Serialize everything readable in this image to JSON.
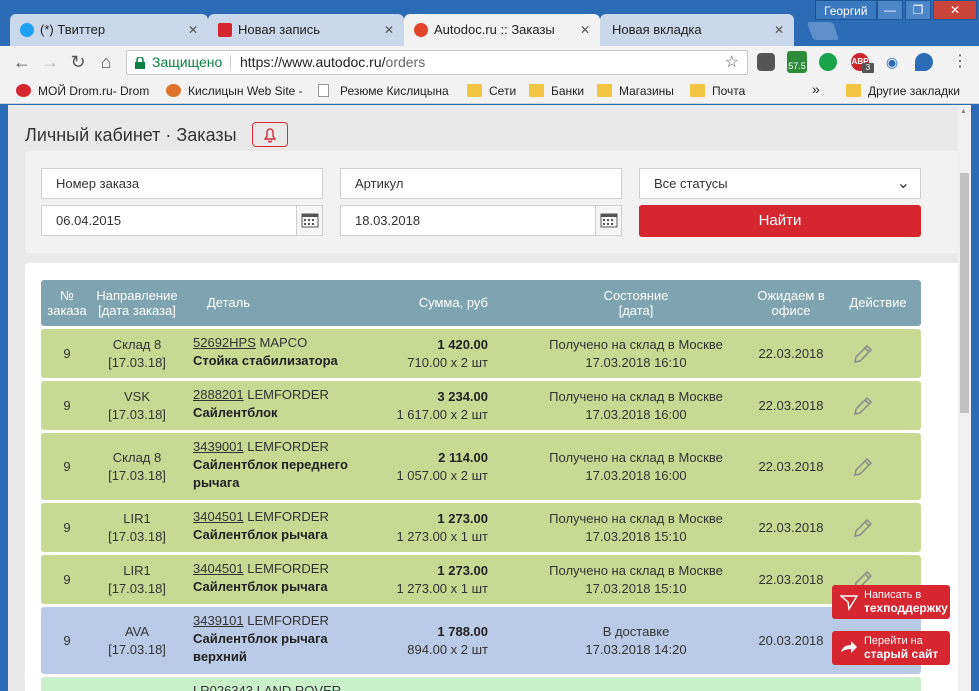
{
  "window": {
    "profile": "Георгий",
    "min": "—",
    "restore": "❐",
    "close": "✕"
  },
  "tabs": [
    {
      "label": "(*) Твиттер",
      "icon_color": "#1da1f2"
    },
    {
      "label": "Новая запись",
      "icon_color": "#d6262f"
    },
    {
      "label": "Autodoc.ru :: Заказы",
      "icon_color": "#e2452b"
    },
    {
      "label": "Новая вкладка",
      "icon_color": ""
    }
  ],
  "tab_close": "✕",
  "toolbar": {
    "secure_label": "Защищено",
    "url_host": "https://www.autodoc.ru/",
    "url_path": "orders",
    "star": "☆",
    "menu": "⋮",
    "ext_price": "57.5",
    "ext_abp_count": "3"
  },
  "bookmarks": [
    {
      "label": "МОЙ Drom.ru- Drom"
    },
    {
      "label": "Кислицын Web Site -"
    },
    {
      "label": "Резюме Кислицына"
    },
    {
      "label": "Сети"
    },
    {
      "label": "Банки"
    },
    {
      "label": "Магазины"
    },
    {
      "label": "Почта"
    }
  ],
  "bookmarks_more": "»",
  "bookmarks_other": "Другие закладки",
  "page": {
    "title": "Личный кабинет · Заказы"
  },
  "filters": {
    "order_number": "Номер заказа",
    "article": "Артикул",
    "status": "Все статусы",
    "date_from": "06.04.2015",
    "date_to": "18.03.2018",
    "find": "Найти"
  },
  "table": {
    "headers": {
      "num": [
        "№",
        "заказа"
      ],
      "dir": [
        "Направление",
        "[дата заказа]"
      ],
      "part": "Деталь",
      "sum": "Сумма, руб",
      "state": [
        "Состояние",
        "[дата]"
      ],
      "expect": [
        "Ожидаем в",
        "офисе"
      ],
      "action": "Действие"
    },
    "rows": [
      {
        "num": "9",
        "dir": "Склад 8",
        "date": "[17.03.18]",
        "code": "52692HPS",
        "brand": "MAPCO",
        "name": "Стойка стабилизатора",
        "name2": "",
        "total": "1 420.00",
        "unit": "710.00 x 2 шт",
        "state": "Получено на склад в Москве",
        "state_date": "17.03.2018 16:10",
        "expect": "22.03.2018",
        "color": "green"
      },
      {
        "num": "9",
        "dir": "VSK",
        "date": "[17.03.18]",
        "code": "2888201",
        "brand": "LEMFORDER",
        "name": "Сайлентблок",
        "name2": "",
        "total": "3 234.00",
        "unit": "1 617.00 x 2 шт",
        "state": "Получено на склад в Москве",
        "state_date": "17.03.2018 16:00",
        "expect": "22.03.2018",
        "color": "green"
      },
      {
        "num": "9",
        "dir": "Склад 8",
        "date": "[17.03.18]",
        "code": "3439001",
        "brand": "LEMFORDER",
        "name": "Сайлентблок переднего",
        "name2": "рычага",
        "total": "2 114.00",
        "unit": "1 057.00 x 2 шт",
        "state": "Получено на склад в Москве",
        "state_date": "17.03.2018 16:00",
        "expect": "22.03.2018",
        "color": "green"
      },
      {
        "num": "9",
        "dir": "LIR1",
        "date": "[17.03.18]",
        "code": "3404501",
        "brand": "LEMFORDER",
        "name": "Сайлентблок рычага",
        "name2": "",
        "total": "1 273.00",
        "unit": "1 273.00 x 1 шт",
        "state": "Получено на склад в Москве",
        "state_date": "17.03.2018 15:10",
        "expect": "22.03.2018",
        "color": "green"
      },
      {
        "num": "9",
        "dir": "LIR1",
        "date": "[17.03.18]",
        "code": "3404501",
        "brand": "LEMFORDER",
        "name": "Сайлентблок рычага",
        "name2": "",
        "total": "1 273.00",
        "unit": "1 273.00 x 1 шт",
        "state": "Получено на склад в Москве",
        "state_date": "17.03.2018 15:10",
        "expect": "22.03.2018",
        "color": "green"
      },
      {
        "num": "9",
        "dir": "AVA",
        "date": "[17.03.18]",
        "code": "3439101",
        "brand": "LEMFORDER",
        "name": "Сайлентблок рычага",
        "name2": "верхний",
        "total": "1 788.00",
        "unit": "894.00 x 2 шт",
        "state": "В доставке",
        "state_date": "17.03.2018 14:20",
        "expect": "20.03.2018",
        "color": "blue"
      },
      {
        "num": "",
        "dir": "",
        "date": "",
        "code": "LR026343",
        "brand": "LAND ROVER",
        "name": "",
        "name2": "",
        "total": "",
        "unit": "",
        "state": "",
        "state_date": "",
        "expect": "",
        "color": "lightgreen"
      }
    ]
  },
  "support": {
    "write_line1": "Написать в",
    "write_line2": "техподдержку",
    "old_line1": "Перейти на",
    "old_line2": "старый сайт"
  }
}
